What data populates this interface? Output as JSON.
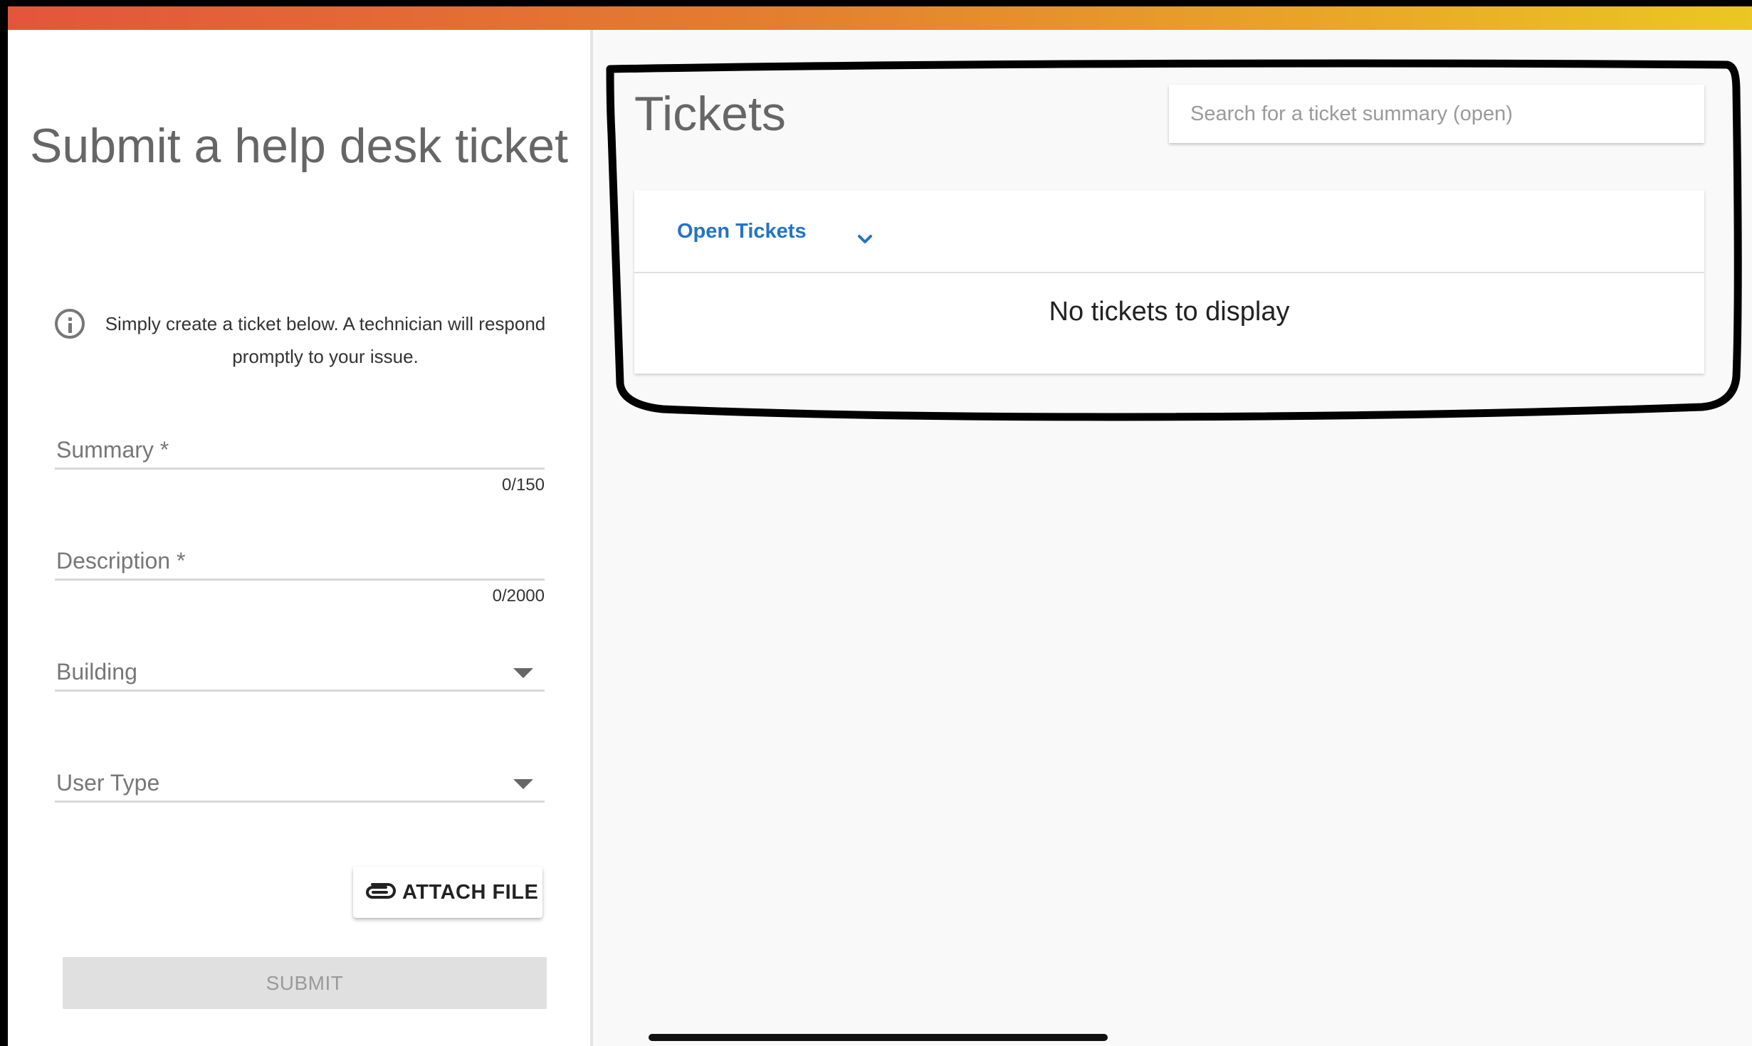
{
  "form": {
    "title": "Submit a help desk ticket",
    "info": "Simply create a ticket below. A technician will respond promptly to your issue.",
    "summary": {
      "label": "Summary *",
      "counter": "0/150"
    },
    "description": {
      "label": "Description *",
      "counter": "0/2000"
    },
    "building": {
      "label": "Building"
    },
    "user_type": {
      "label": "User Type"
    },
    "attach_label": "ATTACH FILE",
    "submit_label": "SUBMIT"
  },
  "tickets": {
    "title": "Tickets",
    "search_placeholder": "Search for a ticket summary (open)",
    "filter_label": "Open Tickets",
    "empty_message": "No tickets to display"
  },
  "colors": {
    "accent_blue": "#2374c5",
    "gradient_start": "#e3553b",
    "gradient_end": "#ebc722",
    "annotation": "#000000"
  },
  "icons": [
    "info-icon",
    "paperclip-icon",
    "chevron-down-icon",
    "caret-down-icon"
  ]
}
